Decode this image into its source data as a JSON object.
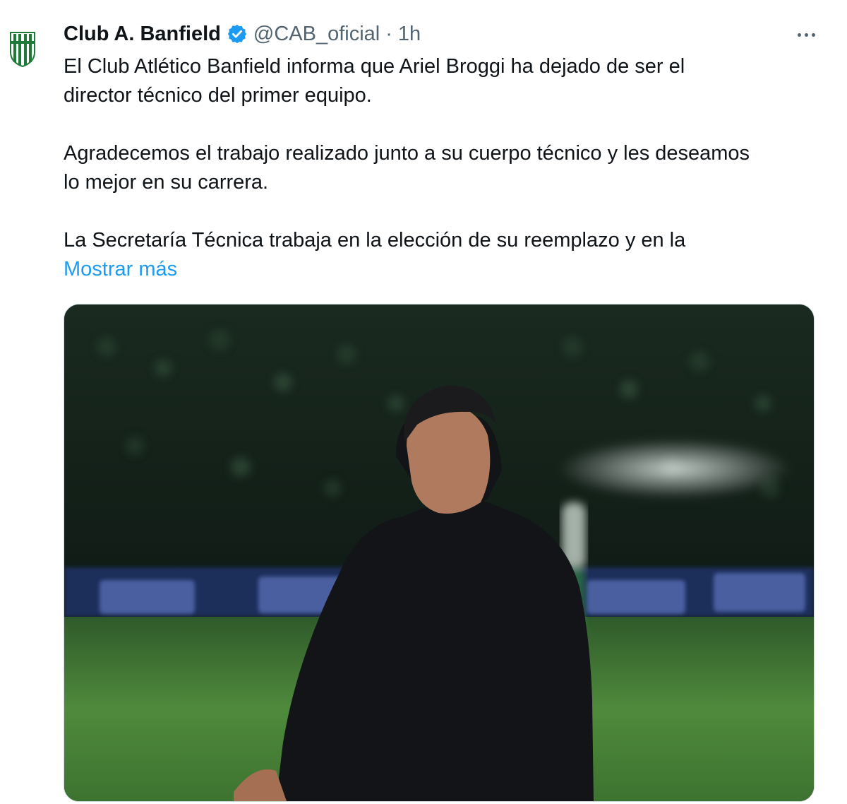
{
  "tweet": {
    "author": {
      "name": "Club A. Banfield",
      "handle": "@CAB_oficial",
      "separator": "·",
      "time": "1h",
      "verified": true,
      "avatar_icon": "banfield-crest-icon",
      "verified_icon": "verified-badge-icon"
    },
    "text": {
      "p1_line1": "El Club Atlético Banfield informa que Ariel Broggi ha dejado de ser el",
      "p1_line2": "director técnico del primer equipo.",
      "p2_line1": "Agradecemos el trabajo realizado junto a su cuerpo técnico y les deseamos",
      "p2_line2": "lo mejor en su carrera.",
      "p3_line1": "La Secretaría Técnica trabaja en la elección de su reemplazo y en la"
    },
    "show_more_label": "Mostrar más",
    "more_icon": "more-options-icon",
    "media": {
      "type": "photo",
      "subject": "coach in black hoodie on stadium pitch at night"
    },
    "colors": {
      "link": "#1d9bf0",
      "secondary_text": "#536471",
      "verified": "#1d9bf0",
      "crest_green": "#1f7a3a"
    }
  }
}
